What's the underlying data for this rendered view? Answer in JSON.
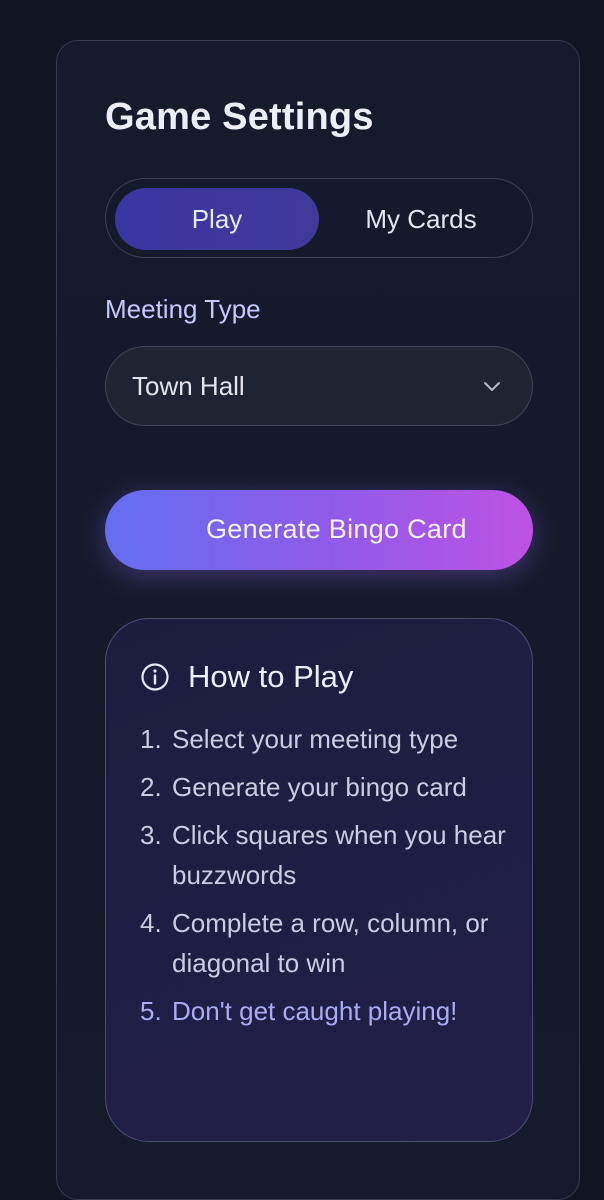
{
  "settings": {
    "title": "Game Settings",
    "tabs": [
      {
        "label": "Play",
        "active": true
      },
      {
        "label": "My Cards",
        "active": false
      }
    ],
    "meeting_type_label": "Meeting Type",
    "meeting_type_value": "Town Hall",
    "generate_label": "Generate Bingo Card"
  },
  "how_to_play": {
    "title": "How to Play",
    "icon": "info-icon",
    "steps": [
      {
        "num": "1.",
        "text": "Select your meeting type"
      },
      {
        "num": "2.",
        "text": "Generate your bingo card"
      },
      {
        "num": "3.",
        "text": "Click squares when you hear buzzwords"
      },
      {
        "num": "4.",
        "text": "Complete a row, column, or diagonal to win"
      },
      {
        "num": "5.",
        "text": "Don't get caught playing!"
      }
    ]
  },
  "colors": {
    "background": "#111423",
    "accent_gradient_start": "#646ef0",
    "accent_gradient_end": "#be52e4",
    "active_tab": "#3a35a0",
    "highlight_step": "#a9acf2"
  }
}
